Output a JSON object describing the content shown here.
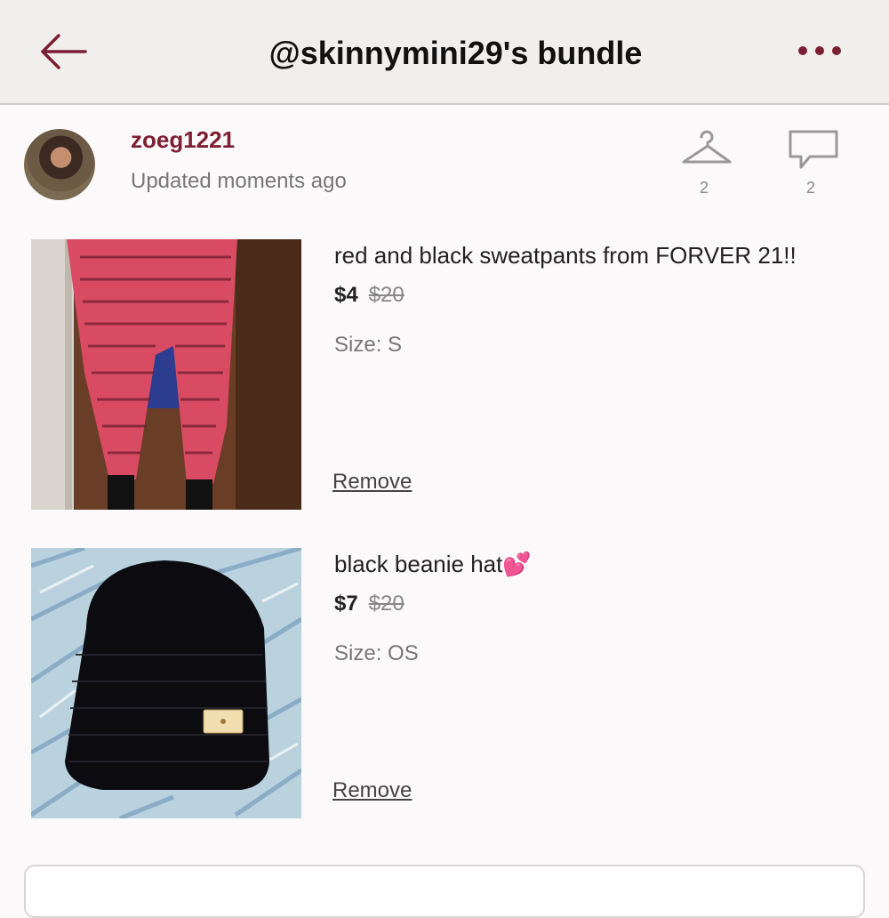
{
  "header": {
    "title": "@skinnymini29's bundle",
    "back_icon": "arrow-left-icon",
    "more_icon": "more-dots-icon",
    "accent_color": "#7d1f33"
  },
  "seller": {
    "username": "zoeg1221",
    "updated": "Updated moments ago",
    "likes_count": "2",
    "comments_count": "2",
    "likes_icon": "hanger-icon",
    "comments_icon": "speech-bubble-icon"
  },
  "items": [
    {
      "title": "red and black sweatpants from FORVER 21!!",
      "price": "$4",
      "original_price": "$20",
      "size": "Size: S",
      "remove_label": "Remove"
    },
    {
      "title": "black beanie hat💕",
      "price": "$7",
      "original_price": "$20",
      "size": "Size: OS",
      "remove_label": "Remove"
    }
  ]
}
